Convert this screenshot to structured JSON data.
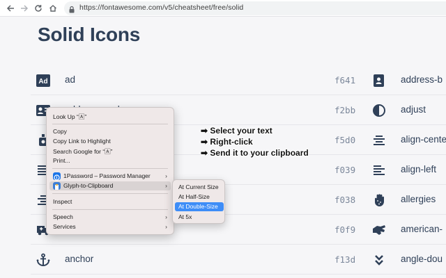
{
  "browser": {
    "url": "https://fontawesome.com/v5/cheatsheet/free/solid"
  },
  "page": {
    "title": "Solid Icons"
  },
  "left_rows": [
    {
      "name": "ad",
      "code": "f641",
      "icon": "ad-icon"
    },
    {
      "name": "address-card",
      "code": "f2bb",
      "icon": "address-card-icon"
    },
    {
      "name": "",
      "code": "f5d0",
      "icon": "air-freshener-icon"
    },
    {
      "name": "",
      "code": "f039",
      "icon": "align-justify-icon"
    },
    {
      "name": "",
      "code": "f038",
      "icon": "align-right-icon"
    },
    {
      "name": "",
      "code": "f0f9",
      "icon": "ambulance-icon"
    },
    {
      "name": "anchor",
      "code": "f13d",
      "icon": "anchor-icon"
    }
  ],
  "right_rows": [
    {
      "name": "address-b",
      "icon": "address-book-icon"
    },
    {
      "name": "adjust",
      "icon": "adjust-icon"
    },
    {
      "name": "align-cente",
      "icon": "align-center-icon"
    },
    {
      "name": "align-left",
      "icon": "align-left-icon"
    },
    {
      "name": "allergies",
      "icon": "allergies-icon"
    },
    {
      "name": "american-",
      "icon": "american-sign-language-icon"
    },
    {
      "name": "angle-dou",
      "icon": "angle-double-down-icon"
    }
  ],
  "context_menu": {
    "look_up": "Look Up “🄰”",
    "copy": "Copy",
    "copy_link": "Copy Link to Highlight",
    "search_google": "Search Google for “🄰”",
    "print": "Print...",
    "onepassword": "1Password – Password Manager",
    "glyph": "Glyph-to-Clipboard",
    "inspect": "Inspect",
    "speech": "Speech",
    "services": "Services",
    "arrow": "›"
  },
  "submenu": {
    "items": [
      "At Current Size",
      "At Half-Size",
      "At Double-Size",
      "At 5x"
    ],
    "selected_index": 2
  },
  "annotations": [
    "➡ Select your text",
    "➡ Right-click",
    "➡ Send it to your clipboard"
  ],
  "colors": {
    "accent": "#3e8df7",
    "icon": "#2f4058"
  }
}
